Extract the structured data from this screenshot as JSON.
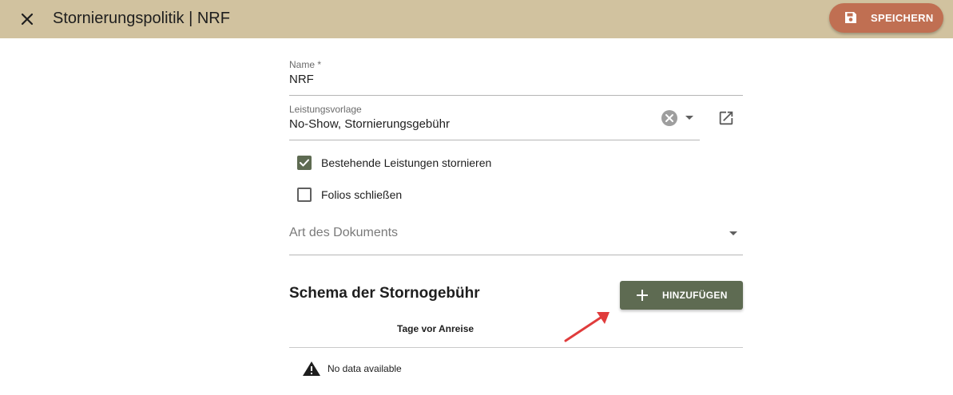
{
  "header": {
    "title": "Stornierungspolitik | NRF",
    "save_label": "SPEICHERN"
  },
  "form": {
    "name_label": "Name *",
    "name_value": "NRF",
    "template_label": "Leistungsvorlage",
    "template_value": "No-Show, Stornierungsgebühr",
    "cancel_existing_label": "Bestehende Leistungen stornieren",
    "cancel_existing_checked": true,
    "close_folios_label": "Folios schließen",
    "close_folios_checked": false,
    "doc_type_placeholder": "Art des Dokuments"
  },
  "schema": {
    "title": "Schema der Stornogebühr",
    "add_label": "HINZUFÜGEN",
    "column_header": "Tage vor Anreise",
    "empty_text": "No data available"
  },
  "colors": {
    "header_bg": "#d1c29f",
    "save_button": "#c06f52",
    "accent_green": "#5e6b52",
    "annotation_arrow": "#e03c3c"
  }
}
